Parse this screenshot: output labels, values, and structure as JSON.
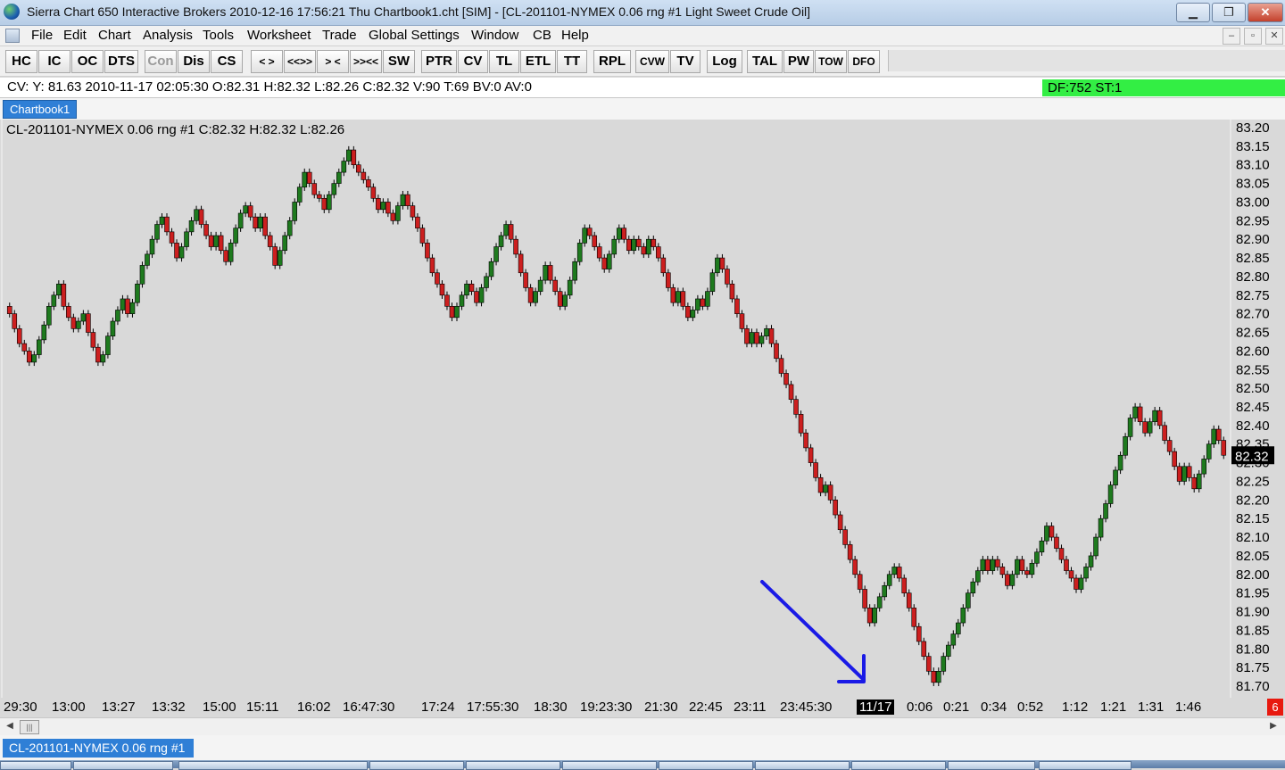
{
  "window": {
    "title": "Sierra Chart 650  Interactive Brokers 2010-12-16  17:56:21  Thu   Chartbook1.cht [SIM] - [CL-201101-NYMEX  0.06 rng  #1  Light Sweet Crude Oil]",
    "minimize_label": "▁",
    "restore_label": "❐",
    "close_label": "✕"
  },
  "menu": {
    "items": [
      "File",
      "Edit",
      "Chart",
      "Analysis",
      "Tools",
      "Worksheet",
      "Trade",
      "Global Settings",
      "Window",
      "CB",
      "Help"
    ],
    "mdi_minimize": "–",
    "mdi_restore": "▫",
    "mdi_close": "✕"
  },
  "toolbar": {
    "buttons": [
      "HC",
      "IC",
      "OC",
      "DTS",
      "Con",
      "Dis",
      "CS",
      "< >",
      "<<>>",
      "> <",
      ">><<",
      "SW",
      "PTR",
      "CV",
      "TL",
      "ETL",
      "TT",
      "RPL",
      "CVW",
      "TV",
      "Log",
      "TAL",
      "PW",
      "TOW",
      "DFO"
    ]
  },
  "cursor_values": "CV: Y: 81.63  2010-11-17  02:05:30  O:82.31  H:82.32  L:82.26  C:82.32  V:90  T:69  BV:0  AV:0",
  "status_box": "DF:752  ST:1",
  "chartbook_tab": "Chartbook1",
  "chart_header": "CL-201101-NYMEX  0.06 rng  #1 C:82.32 H:82.32 L:82.26",
  "price_axis": {
    "labels": [
      "83.20",
      "83.15",
      "83.10",
      "83.05",
      "83.00",
      "82.95",
      "82.90",
      "82.85",
      "82.80",
      "82.75",
      "82.70",
      "82.65",
      "82.60",
      "82.55",
      "82.50",
      "82.45",
      "82.40",
      "82.35",
      "82.30",
      "82.25",
      "82.20",
      "82.15",
      "82.10",
      "82.05",
      "82.00",
      "81.95",
      "81.90",
      "81.85",
      "81.80",
      "81.75",
      "81.70"
    ],
    "current_price": "82.32"
  },
  "time_axis": {
    "labels": [
      "29:30",
      "13:00",
      "13:27",
      "13:32",
      "15:00",
      "15:11",
      "16:02",
      "16:47:30",
      "17:24",
      "17:55:30",
      "18:30",
      "19:23:30",
      "21:30",
      "22:45",
      "23:11",
      "23:45:30",
      "0:06",
      "0:21",
      "0:34",
      "0:52",
      "1:12",
      "1:21",
      "1:31",
      "1:46"
    ],
    "date_marker": "11/17",
    "badge": "6"
  },
  "bottom_tab": "CL-201101-NYMEX 0.06 rng  #1",
  "colors": {
    "up_candle": "#1e7a1e",
    "down_candle": "#cc1f1f",
    "chart_bg": "#d9d9d9",
    "arrow": "#1a1ae6",
    "status_green": "#33ee44",
    "tab_blue": "#2f7fd6"
  },
  "chart_data": {
    "type": "candlestick",
    "title": "CL-201101-NYMEX  0.06 rng  #1",
    "ylim": [
      81.68,
      83.21
    ],
    "close_series": [
      82.7,
      82.66,
      82.62,
      82.6,
      82.57,
      82.59,
      82.63,
      82.67,
      82.72,
      82.75,
      82.78,
      82.72,
      82.69,
      82.66,
      82.68,
      82.7,
      82.65,
      82.61,
      82.57,
      82.59,
      82.64,
      82.68,
      82.71,
      82.74,
      82.7,
      82.73,
      82.78,
      82.83,
      82.86,
      82.9,
      82.94,
      82.96,
      82.92,
      82.89,
      82.85,
      82.88,
      82.92,
      82.95,
      82.98,
      82.94,
      82.91,
      82.88,
      82.91,
      82.87,
      82.84,
      82.89,
      82.93,
      82.97,
      82.99,
      82.96,
      82.93,
      82.96,
      82.91,
      82.88,
      82.83,
      82.87,
      82.91,
      82.95,
      83.0,
      83.04,
      83.08,
      83.05,
      83.02,
      83.01,
      82.98,
      83.02,
      83.05,
      83.08,
      83.11,
      83.14,
      83.1,
      83.08,
      83.06,
      83.04,
      83.01,
      82.98,
      83.0,
      82.97,
      82.95,
      82.99,
      83.02,
      82.99,
      82.96,
      82.93,
      82.89,
      82.85,
      82.81,
      82.78,
      82.75,
      82.72,
      82.69,
      82.72,
      82.75,
      82.78,
      82.76,
      82.73,
      82.77,
      82.8,
      82.84,
      82.88,
      82.91,
      82.94,
      82.9,
      82.86,
      82.81,
      82.77,
      82.73,
      82.76,
      82.79,
      82.83,
      82.79,
      82.76,
      82.72,
      82.75,
      82.79,
      82.84,
      82.89,
      82.93,
      82.91,
      82.88,
      82.85,
      82.82,
      82.86,
      82.9,
      82.93,
      82.9,
      82.87,
      82.9,
      82.88,
      82.86,
      82.9,
      82.88,
      82.85,
      82.81,
      82.77,
      82.73,
      82.76,
      82.72,
      82.69,
      82.71,
      82.74,
      82.72,
      82.76,
      82.81,
      82.85,
      82.82,
      82.78,
      82.74,
      82.7,
      82.66,
      82.62,
      82.65,
      82.62,
      82.64,
      82.66,
      82.62,
      82.58,
      82.54,
      82.51,
      82.47,
      82.43,
      82.38,
      82.34,
      82.3,
      82.26,
      82.22,
      82.24,
      82.2,
      82.16,
      82.12,
      82.08,
      82.04,
      82.0,
      81.96,
      81.91,
      81.87,
      81.91,
      81.94,
      81.97,
      82.0,
      82.02,
      81.99,
      81.95,
      81.91,
      81.86,
      81.82,
      81.78,
      81.74,
      81.71,
      81.74,
      81.78,
      81.81,
      81.84,
      81.87,
      81.91,
      81.95,
      81.98,
      82.01,
      82.04,
      82.01,
      82.04,
      82.02,
      82.0,
      81.97,
      82.0,
      82.04,
      82.01,
      82.0,
      82.03,
      82.06,
      82.09,
      82.13,
      82.1,
      82.07,
      82.04,
      82.01,
      81.99,
      81.96,
      81.99,
      82.02,
      82.05,
      82.1,
      82.15,
      82.19,
      82.24,
      82.28,
      82.32,
      82.37,
      82.42,
      82.45,
      82.41,
      82.38,
      82.41,
      82.44,
      82.4,
      82.36,
      82.33,
      82.29,
      82.25,
      82.29,
      82.26,
      82.23,
      82.27,
      82.31,
      82.35,
      82.39,
      82.36,
      82.32
    ]
  }
}
